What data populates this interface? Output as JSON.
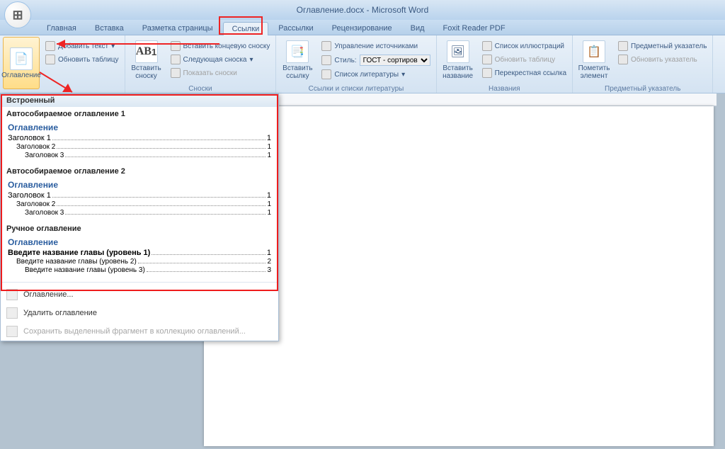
{
  "app_title": "Оглавление.docx - Microsoft Word",
  "tabs": [
    "Главная",
    "Вставка",
    "Разметка страницы",
    "Ссылки",
    "Рассылки",
    "Рецензирование",
    "Вид",
    "Foxit Reader PDF"
  ],
  "active_tab_index": 3,
  "ribbon": {
    "toc": {
      "main": "Оглавление",
      "add_text": "Добавить текст",
      "update_table": "Обновить таблицу",
      "group_label": ""
    },
    "footnotes": {
      "insert": "Вставить сноску",
      "end": "Вставить концевую сноску",
      "next": "Следующая сноска",
      "show": "Показать сноски",
      "group_label": "Сноски"
    },
    "citations": {
      "insert": "Вставить ссылку",
      "manage": "Управление источниками",
      "style_label": "Стиль:",
      "style_value": "ГОСТ - сортиров",
      "biblio": "Список литературы",
      "group_label": "Ссылки и списки литературы"
    },
    "captions": {
      "insert": "Вставить название",
      "figures": "Список иллюстраций",
      "update": "Обновить таблицу",
      "crossref": "Перекрестная ссылка",
      "group_label": "Названия"
    },
    "index": {
      "mark": "Пометить элемент",
      "insert": "Предметный указатель",
      "update": "Обновить указатель",
      "group_label": "Предметный указатель"
    }
  },
  "gallery": {
    "builtin": "Встроенный",
    "auto1": "Автособираемое оглавление 1",
    "auto2": "Автособираемое оглавление 2",
    "manual": "Ручное оглавление",
    "toc_word": "Оглавление",
    "rows_auto": [
      {
        "label": "Заголовок 1",
        "page": "1",
        "lvl": 1
      },
      {
        "label": "Заголовок 2",
        "page": "1",
        "lvl": 2
      },
      {
        "label": "Заголовок 3",
        "page": "1",
        "lvl": 3
      }
    ],
    "rows_manual": [
      {
        "label": "Введите название главы (уровень 1)",
        "page": "1",
        "lvl": 1
      },
      {
        "label": "Введите название главы (уровень 2)",
        "page": "2",
        "lvl": 2
      },
      {
        "label": "Введите название главы (уровень 3)",
        "page": "3",
        "lvl": 3
      }
    ],
    "menu_insert": "Оглавление...",
    "menu_remove": "Удалить оглавление",
    "menu_save": "Сохранить выделенный фрагмент в коллекцию оглавлений..."
  }
}
